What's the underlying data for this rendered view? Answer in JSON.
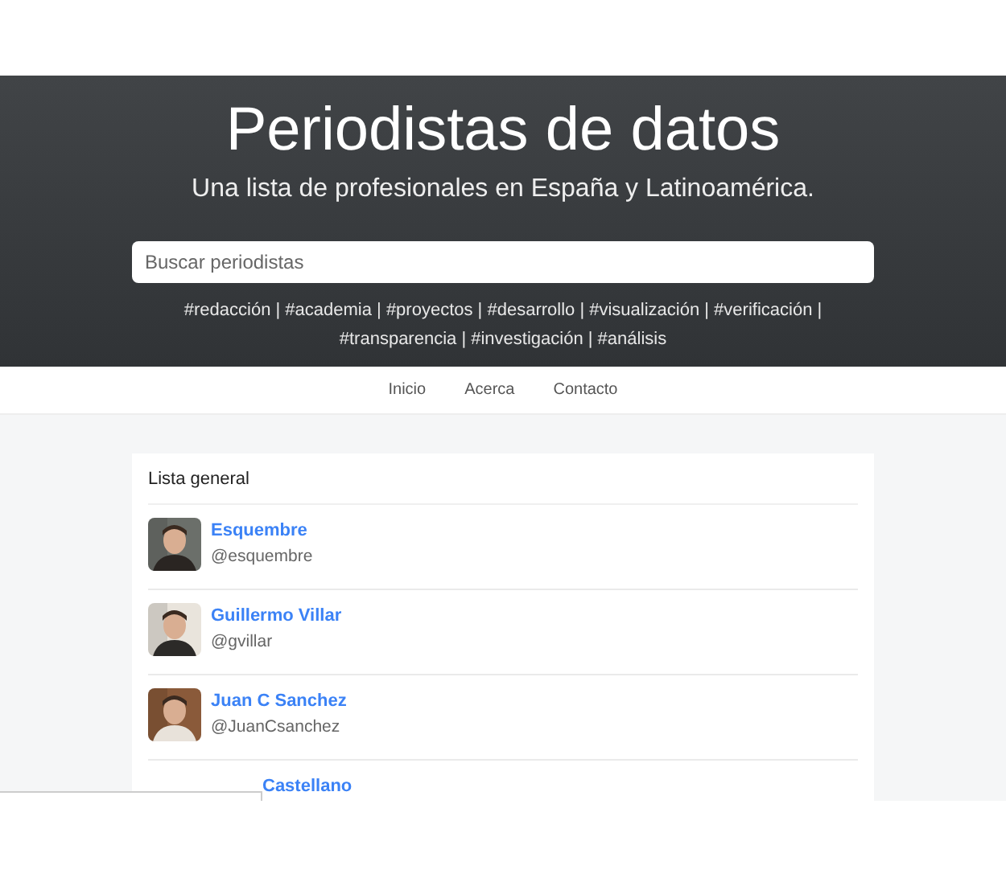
{
  "header": {
    "title": "Periodistas de datos",
    "subtitle": "Una lista de profesionales en España y Latinoamérica.",
    "search": {
      "placeholder": "Buscar periodistas"
    },
    "tags": "#redacción | #academia | #proyectos | #desarrollo | #visualización | #verificación | #transparencia | #investigación | #análisis"
  },
  "nav": [
    "Inicio",
    "Acerca",
    "Contacto"
  ],
  "list": {
    "title": "Lista general",
    "people": [
      {
        "kind": "full",
        "name": "Esquembre",
        "handle": "@esquembre"
      },
      {
        "kind": "full",
        "name": "Guillermo Villar",
        "handle": "@gvillar"
      },
      {
        "kind": "full",
        "name": "Juan C Sanchez",
        "handle": "@JuanCsanchez"
      },
      {
        "kind": "covered",
        "name": "Castellano"
      }
    ]
  }
}
